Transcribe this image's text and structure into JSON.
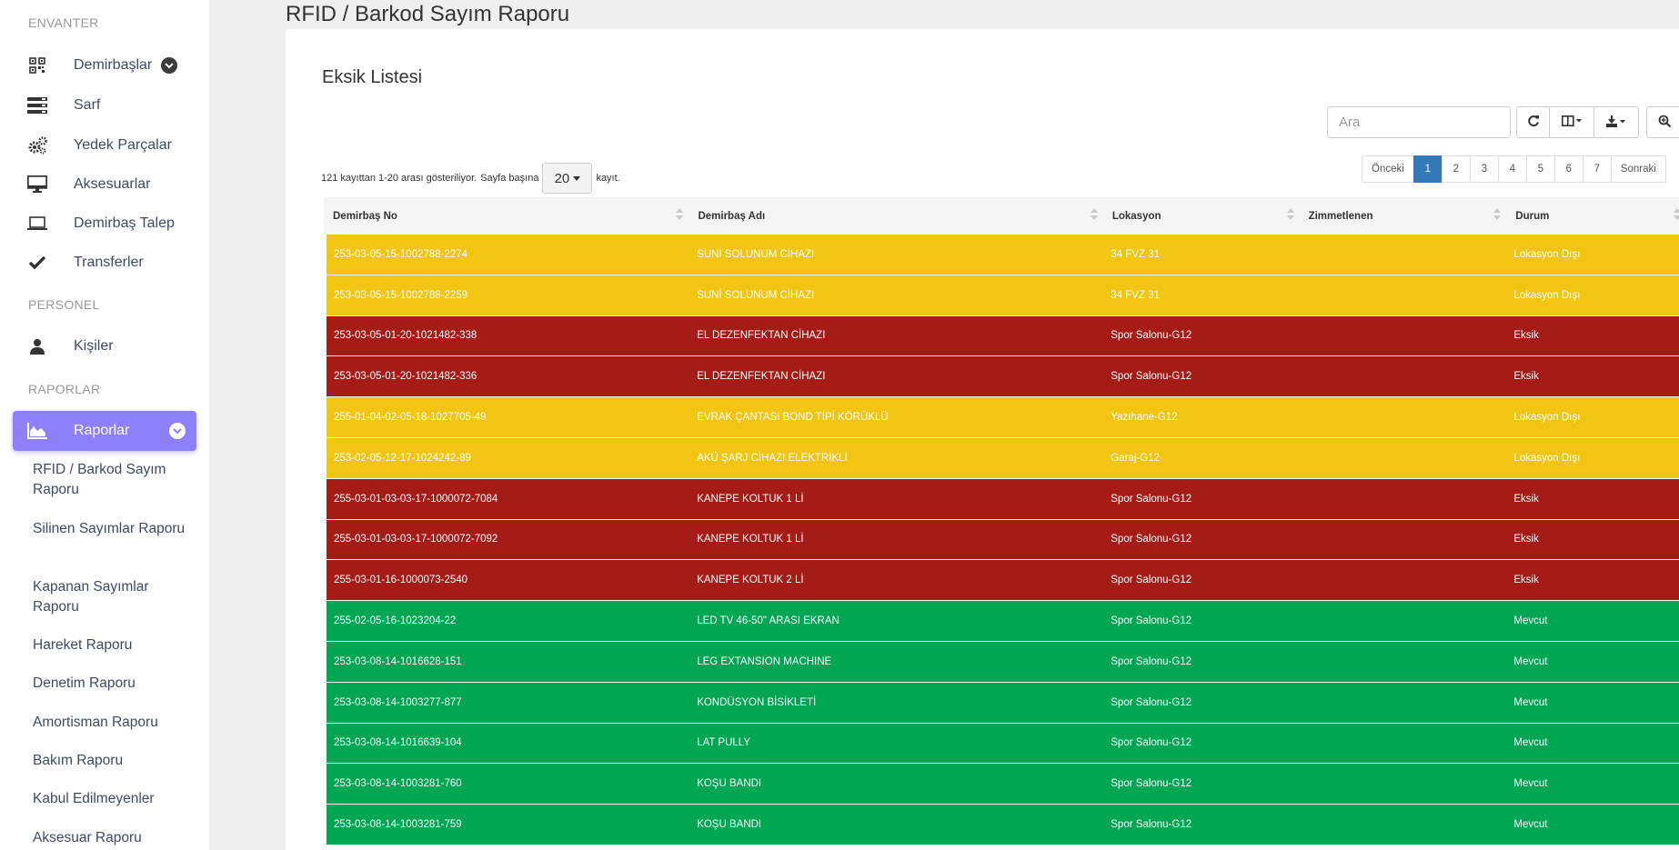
{
  "sidebar": {
    "sections": {
      "envanter": "ENVANTER",
      "personel": "PERSONEL",
      "raporlar": "RAPORLAR"
    },
    "items": {
      "demirbaslar": "Demirbaşlar",
      "sarf": "Sarf",
      "yedek": "Yedek Parçalar",
      "aksesuarlar": "Aksesuarlar",
      "talep": "Demirbaş Talep",
      "transferler": "Transferler",
      "kisiler": "Kişiler",
      "raporlar": "Raporlar"
    },
    "sub_items": [
      "RFID / Barkod Sayım Raporu",
      "Silinen Sayımlar Raporu",
      "Kapanan Sayımlar Raporu",
      "Hareket Raporu",
      "Denetim Raporu",
      "Amortisman Raporu",
      "Bakım Raporu",
      "Kabul Edilmeyenler",
      "Aksesuar Raporu"
    ]
  },
  "page": {
    "title": "RFID / Barkod Sayım Raporu"
  },
  "card": {
    "title": "Eksik Listesi",
    "search_placeholder": "Ara",
    "info_prefix": "121 kayıttan 1-20 arası gösteriliyor.",
    "per_page_label": "Sayfa başına",
    "per_page_value": "20",
    "per_page_suffix": "kayıt."
  },
  "pager": {
    "prev": "Önceki",
    "pages": [
      "1",
      "2",
      "3",
      "4",
      "5",
      "6",
      "7"
    ],
    "next": "Sonraki",
    "active_page": "1"
  },
  "table": {
    "headers": [
      "Demirbaş No",
      "Demirbaş Adı",
      "Lokasyon",
      "Zimmetlenen",
      "Durum"
    ],
    "row_colors": {
      "Lokasyon Dışı": "#f2c513",
      "Eksik": "#a51b16",
      "Mevcut": "#00a651"
    },
    "rows": [
      {
        "no": "253-03-05-15-1002788-2274",
        "name": "SUNİ SOLUNUM CİHAZI",
        "loc": "34 FVZ 31",
        "zimmet": "",
        "status": "Lokasyon Dışı",
        "color": "yellow"
      },
      {
        "no": "253-03-05-15-1002788-2259",
        "name": "SUNİ SOLUNUM CİHAZI",
        "loc": "34 FVZ 31",
        "zimmet": "",
        "status": "Lokasyon Dışı",
        "color": "yellow"
      },
      {
        "no": "253-03-05-01-20-1021482-338",
        "name": "EL DEZENFEKTAN CİHAZI",
        "loc": "Spor Salonu-G12",
        "zimmet": "",
        "status": "Eksik",
        "color": "red"
      },
      {
        "no": "253-03-05-01-20-1021482-336",
        "name": "EL DEZENFEKTAN CİHAZI",
        "loc": "Spor Salonu-G12",
        "zimmet": "",
        "status": "Eksik",
        "color": "red"
      },
      {
        "no": "255-01-04-02-05-18-1027705-49",
        "name": "EVRAK ÇANTASI BOND TİPİ KÖRÜKLÜ",
        "loc": "Yazıhane-G12",
        "zimmet": "",
        "status": "Lokasyon Dışı",
        "color": "yellow"
      },
      {
        "no": "253-02-05-12-17-1024242-89",
        "name": "AKÜ ŞARJ CİHAZI ELEKTRİKLİ",
        "loc": "Garaj-G12",
        "zimmet": "",
        "status": "Lokasyon Dışı",
        "color": "yellow"
      },
      {
        "no": "255-03-01-03-03-17-1000072-7084",
        "name": "KANEPE KOLTUK 1 Lİ",
        "loc": "Spor Salonu-G12",
        "zimmet": "",
        "status": "Eksik",
        "color": "red"
      },
      {
        "no": "255-03-01-03-03-17-1000072-7092",
        "name": "KANEPE KOLTUK 1 Lİ",
        "loc": "Spor Salonu-G12",
        "zimmet": "",
        "status": "Eksik",
        "color": "red"
      },
      {
        "no": "255-03-01-16-1000073-2540",
        "name": "KANEPE KOLTUK 2 Lİ",
        "loc": "Spor Salonu-G12",
        "zimmet": "",
        "status": "Eksik",
        "color": "red"
      },
      {
        "no": "255-02-05-16-1023204-22",
        "name": "LED TV 46-50\" ARASI EKRAN",
        "loc": "Spor Salonu-G12",
        "zimmet": "",
        "status": "Mevcut",
        "color": "green"
      },
      {
        "no": "253-03-08-14-1016628-151",
        "name": "LEG EXTANSION MACHINE",
        "loc": "Spor Salonu-G12",
        "zimmet": "",
        "status": "Mevcut",
        "color": "green"
      },
      {
        "no": "253-03-08-14-1003277-877",
        "name": "KONDÜSYON BİSİKLETİ",
        "loc": "Spor Salonu-G12",
        "zimmet": "",
        "status": "Mevcut",
        "color": "green"
      },
      {
        "no": "253-03-08-14-1016639-104",
        "name": "LAT PULLY",
        "loc": "Spor Salonu-G12",
        "zimmet": "",
        "status": "Mevcut",
        "color": "green"
      },
      {
        "no": "253-03-08-14-1003281-760",
        "name": "KOŞU BANDI",
        "loc": "Spor Salonu-G12",
        "zimmet": "",
        "status": "Mevcut",
        "color": "green"
      },
      {
        "no": "253-03-08-14-1003281-759",
        "name": "KOŞU BANDI",
        "loc": "Spor Salonu-G12",
        "zimmet": "",
        "status": "Mevcut",
        "color": "green"
      }
    ]
  }
}
